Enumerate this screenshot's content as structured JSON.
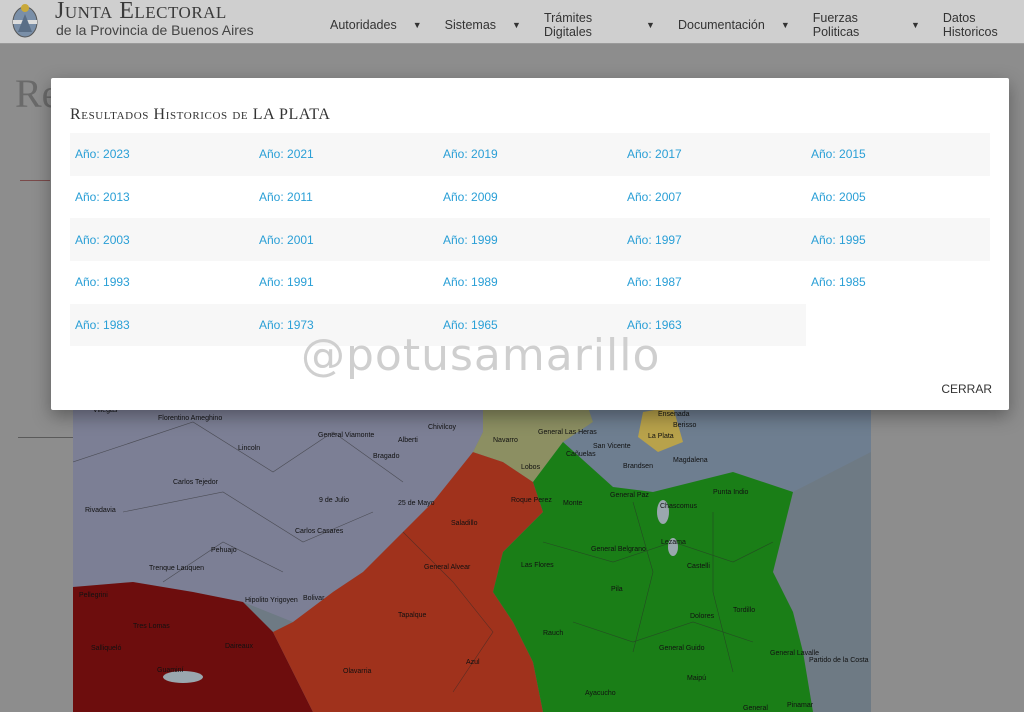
{
  "header": {
    "title": "Junta Electoral",
    "subtitle": "de la Provincia de Buenos Aires",
    "nav": [
      {
        "label": "Autoridades"
      },
      {
        "label": "Sistemas"
      },
      {
        "label": "Trámites Digitales"
      },
      {
        "label": "Documentación"
      },
      {
        "label": "Fuerzas Politicas"
      },
      {
        "label": "Datos Historicos"
      }
    ]
  },
  "background": {
    "title_partial": "Re",
    "map_labels": [
      "Villegas",
      "Florentino Ameghino",
      "Lincoln",
      "General Viamonte",
      "Alberti",
      "Chivilcoy",
      "Navarro",
      "General Las Heras",
      "Ensenada",
      "Berisso",
      "La Plata",
      "Bragado",
      "Lobos",
      "Cañuelas",
      "San Vicente",
      "Brandsen",
      "Magdalena",
      "Carlos Tejedor",
      "Rivadavia",
      "9 de Julio",
      "25 de Mayo",
      "Roque Perez",
      "Saladillo",
      "Monte",
      "General Paz",
      "Punta Indio",
      "Chascomus",
      "Carlos Casares",
      "Trenque Lauquen",
      "Pehuajo",
      "General Alvear",
      "Las Flores",
      "General Belgrano",
      "Lezama",
      "Castelli",
      "Pila",
      "Dolores",
      "Tordillo",
      "Hipolito Yrigoyen",
      "Bolivar",
      "Tapalque",
      "Pellegrini",
      "Tres Lomas",
      "Salliqueló",
      "Guaminí",
      "Daireaux",
      "Rauch",
      "General Guido",
      "General Lavalle",
      "Partido de la Costa",
      "Olavarria",
      "Azul",
      "Maipú",
      "Ayacucho",
      "Pinamar",
      "General"
    ]
  },
  "modal": {
    "title": "Resultados Historicos de LA PLATA",
    "years": [
      [
        "Año: 2023",
        "Año: 2021",
        "Año: 2019",
        "Año: 2017",
        "Año: 2015"
      ],
      [
        "Año: 2013",
        "Año: 2011",
        "Año: 2009",
        "Año: 2007",
        "Año: 2005"
      ],
      [
        "Año: 2003",
        "Año: 2001",
        "Año: 1999",
        "Año: 1997",
        "Año: 1995"
      ],
      [
        "Año: 1993",
        "Año: 1991",
        "Año: 1989",
        "Año: 1987",
        "Año: 1985"
      ],
      [
        "Año: 1983",
        "Año: 1973",
        "Año: 1965",
        "Año: 1963"
      ]
    ],
    "watermark": "@potusamarillo",
    "close_label": "CERRAR"
  },
  "colors": {
    "link": "#2a9fd6",
    "map_purple": "#7c7f95",
    "map_red_orange": "#a0321c",
    "map_dark_red": "#6d0d0d",
    "map_green": "#1a7e17",
    "map_khaki": "#8c8f62",
    "map_steel": "#6e7e90",
    "map_la_plata": "#b8a24b"
  }
}
